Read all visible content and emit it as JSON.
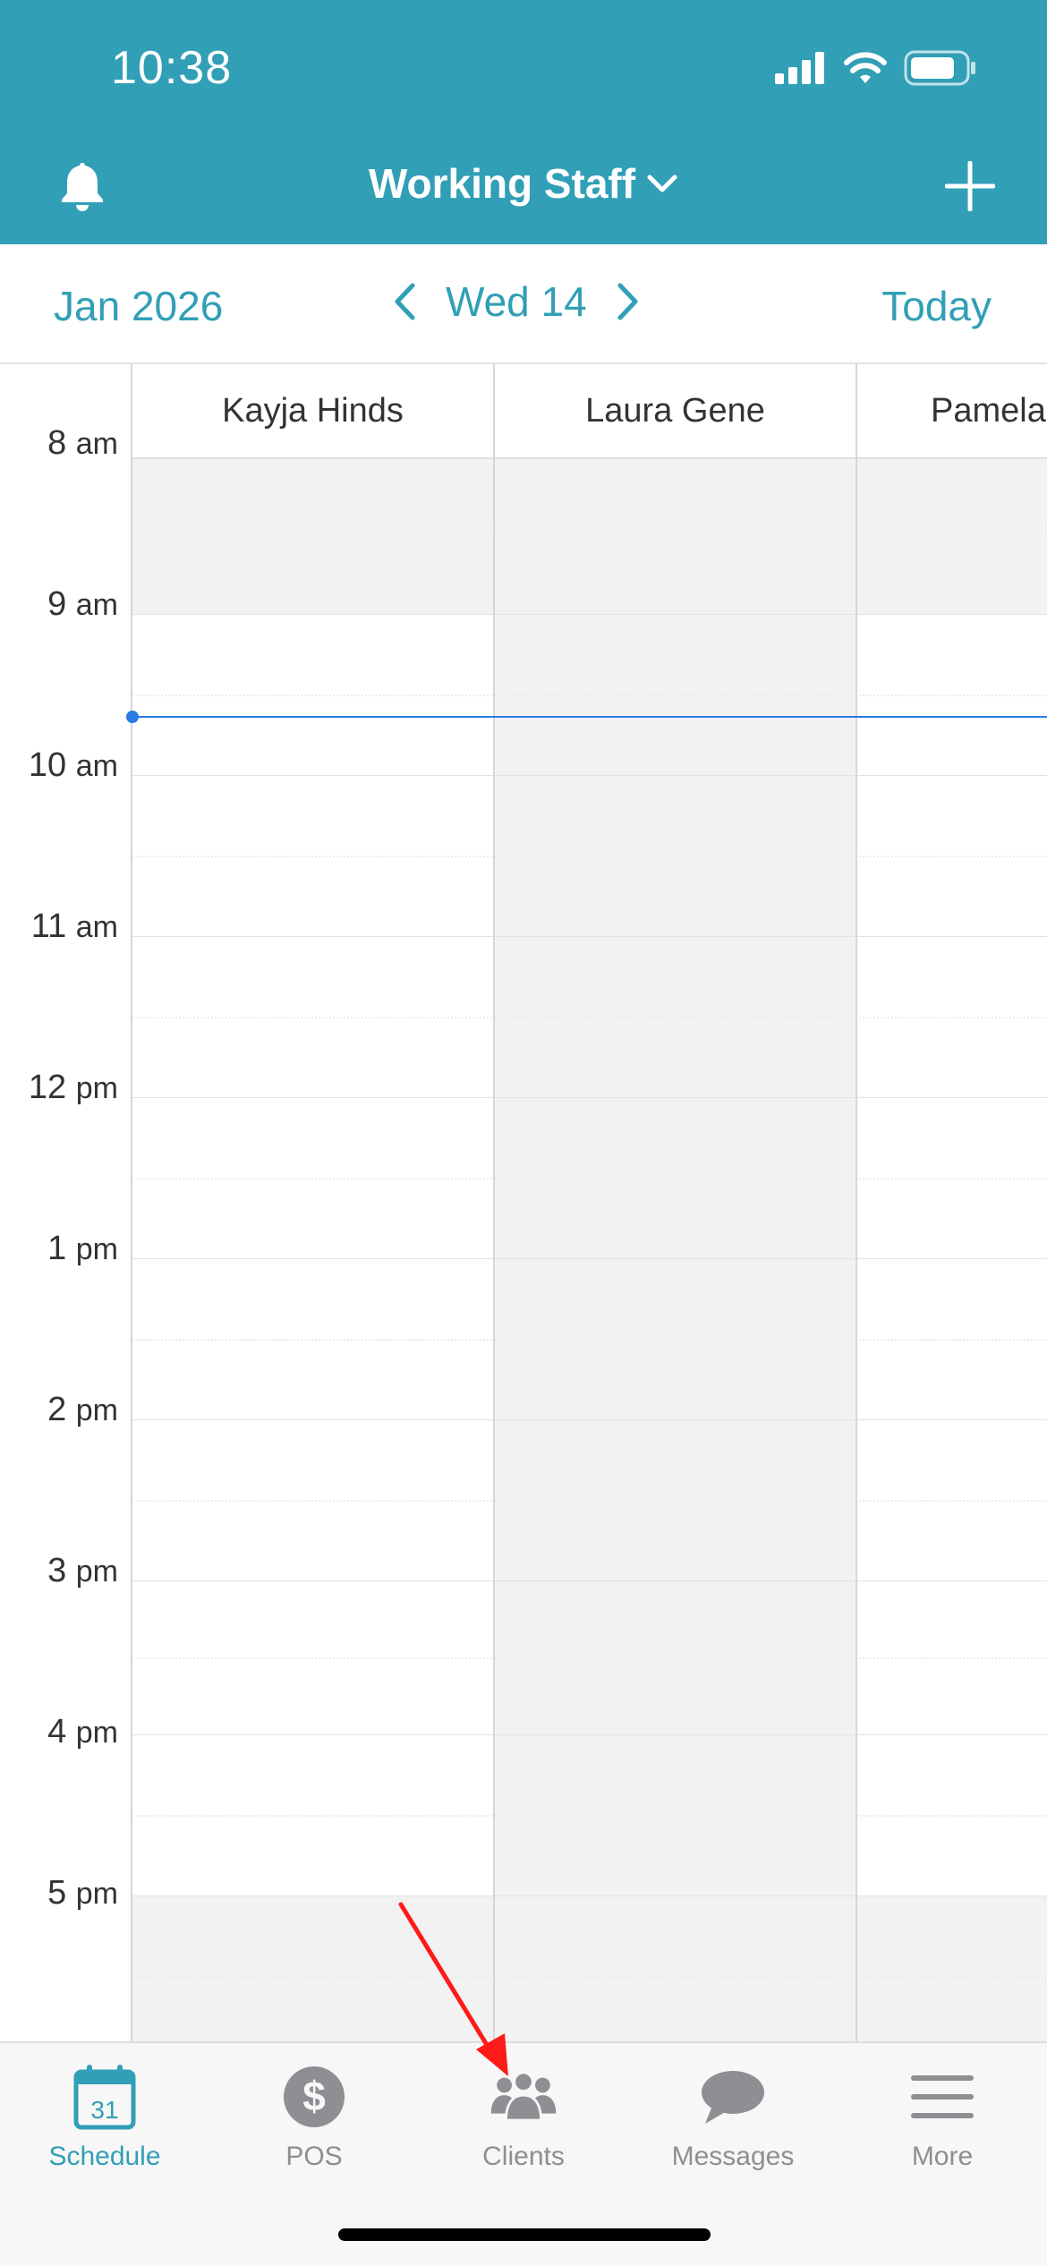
{
  "status_bar": {
    "time": "10:38"
  },
  "header": {
    "title": "Working Staff",
    "bell_icon": "bell-icon",
    "add_icon": "plus-icon"
  },
  "date_bar": {
    "month": "Jan 2026",
    "day": "Wed 14",
    "today_label": "Today"
  },
  "staff": [
    "Kayja Hinds",
    "Laura Gene",
    "Pamela"
  ],
  "times": [
    {
      "num": "8",
      "suf": "am"
    },
    {
      "num": "9",
      "suf": "am"
    },
    {
      "num": "10",
      "suf": "am"
    },
    {
      "num": "11",
      "suf": "am"
    },
    {
      "num": "12",
      "suf": "pm"
    },
    {
      "num": "1",
      "suf": "pm"
    },
    {
      "num": "2",
      "suf": "pm"
    },
    {
      "num": "3",
      "suf": "pm"
    },
    {
      "num": "4",
      "suf": "pm"
    },
    {
      "num": "5",
      "suf": "pm"
    }
  ],
  "tabs": [
    {
      "label": "Schedule",
      "icon": "calendar-icon",
      "badge": "31",
      "active": true
    },
    {
      "label": "POS",
      "icon": "dollar-icon",
      "active": false
    },
    {
      "label": "Clients",
      "icon": "clients-icon",
      "active": false
    },
    {
      "label": "Messages",
      "icon": "chat-icon",
      "active": false
    },
    {
      "label": "More",
      "icon": "menu-icon",
      "active": false
    }
  ],
  "colors": {
    "brand": "#319fb6",
    "now_line": "#2c7be5",
    "annotation": "#ff1a1a"
  }
}
